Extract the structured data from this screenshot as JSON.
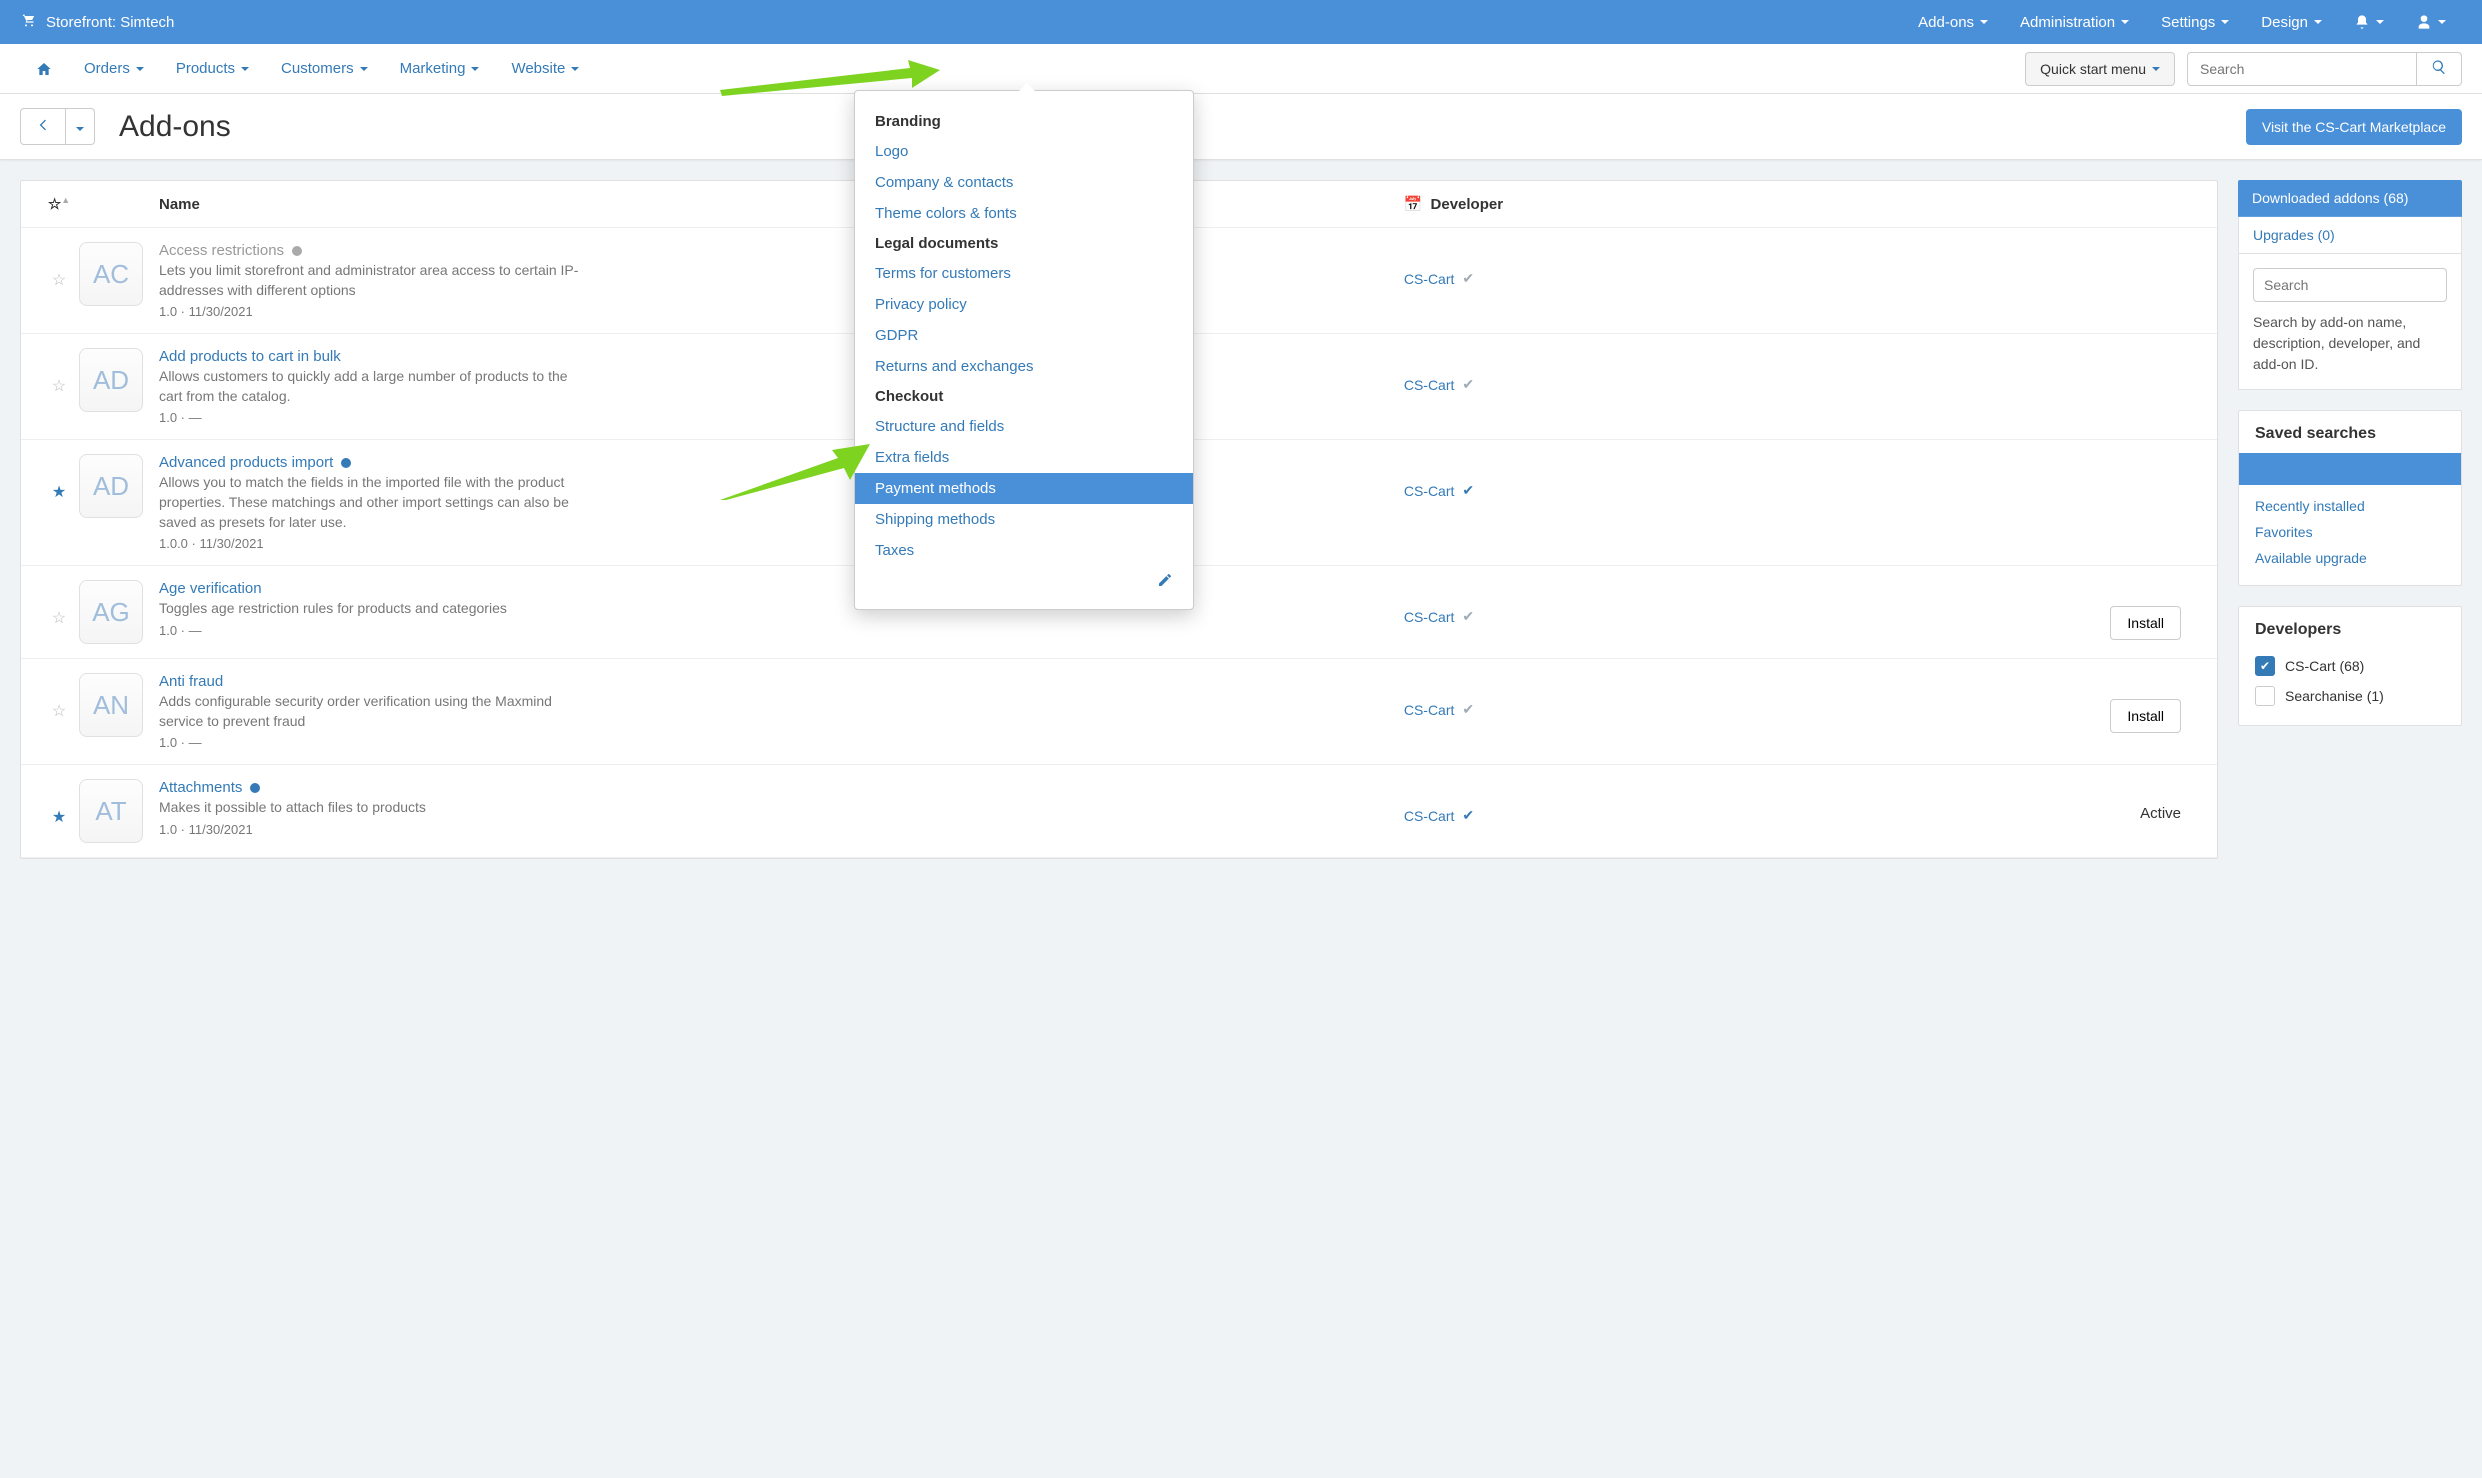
{
  "topbar": {
    "storefront": "Storefront: Simtech",
    "menus": [
      "Add-ons",
      "Administration",
      "Settings",
      "Design"
    ]
  },
  "nav": [
    "Orders",
    "Products",
    "Customers",
    "Marketing",
    "Website"
  ],
  "quick_start": "Quick start menu",
  "search_ph": "Search",
  "page_title": "Add-ons",
  "visit_btn": "Visit the CS-Cart Marketplace",
  "th": {
    "name": "Name",
    "dev": "Developer"
  },
  "addons": [
    {
      "code": "AC",
      "titleMuted": true,
      "fav": false,
      "title": "Access restrictions",
      "dotGrey": true,
      "desc": "Lets you limit storefront and administrator area access to certain IP-addresses with different options",
      "meta": "1.0 · 11/30/2021",
      "dev": "CS-Cart",
      "check": "grey",
      "action": ""
    },
    {
      "code": "AD",
      "titleMuted": false,
      "fav": false,
      "title": "Add products to cart in bulk",
      "desc": "Allows customers to quickly add a large number of products to the cart from the catalog.",
      "meta": "1.0 · —",
      "dev": "CS-Cart",
      "check": "grey",
      "action": ""
    },
    {
      "code": "AD",
      "titleMuted": false,
      "fav": true,
      "title": "Advanced products import",
      "dot": true,
      "desc": "Allows you to match the fields in the imported file with the product properties. These matchings and other import settings can also be saved as presets for later use.",
      "meta": "1.0.0 · 11/30/2021",
      "dev": "CS-Cart",
      "check": "blue",
      "action": ""
    },
    {
      "code": "AG",
      "titleMuted": false,
      "fav": false,
      "title": "Age verification",
      "desc": "Toggles age restriction rules for products and categories",
      "meta": "1.0 · —",
      "dev": "CS-Cart",
      "check": "grey",
      "action": "install"
    },
    {
      "code": "AN",
      "titleMuted": false,
      "fav": false,
      "title": "Anti fraud",
      "desc": "Adds configurable security order verification using the Maxmind service to prevent fraud",
      "meta": "1.0 · —",
      "dev": "CS-Cart",
      "check": "grey",
      "action": "install"
    },
    {
      "code": "AT",
      "titleMuted": false,
      "fav": true,
      "title": "Attachments",
      "dot": true,
      "desc": "Makes it possible to attach files to products",
      "meta": "1.0 · 11/30/2021",
      "dev": "CS-Cart",
      "check": "blue",
      "action": "active"
    }
  ],
  "install_label": "Install",
  "active_label": "Active",
  "side": {
    "tab1": "Downloaded addons (68)",
    "tab2": "Upgrades (0)",
    "search_ph": "Search",
    "search_hint": "Search by add-on name, description, developer, and add-on ID.",
    "saved": "Saved searches",
    "links": [
      "Recently installed",
      "Favorites",
      "Available upgrade"
    ],
    "devs": "Developers",
    "dev_list": [
      {
        "n": "CS-Cart (68)",
        "on": true
      },
      {
        "n": "Searchanise (1)",
        "on": false
      }
    ]
  },
  "dd": {
    "g1": "Branding",
    "g1i": [
      "Logo",
      "Company & contacts",
      "Theme colors & fonts"
    ],
    "g2": "Legal documents",
    "g2i": [
      "Terms for customers",
      "Privacy policy",
      "GDPR",
      "Returns and exchanges"
    ],
    "g3": "Checkout",
    "g3i": [
      "Structure and fields",
      "Extra fields",
      "Payment methods",
      "Shipping methods",
      "Taxes"
    ],
    "active": "Payment methods"
  }
}
